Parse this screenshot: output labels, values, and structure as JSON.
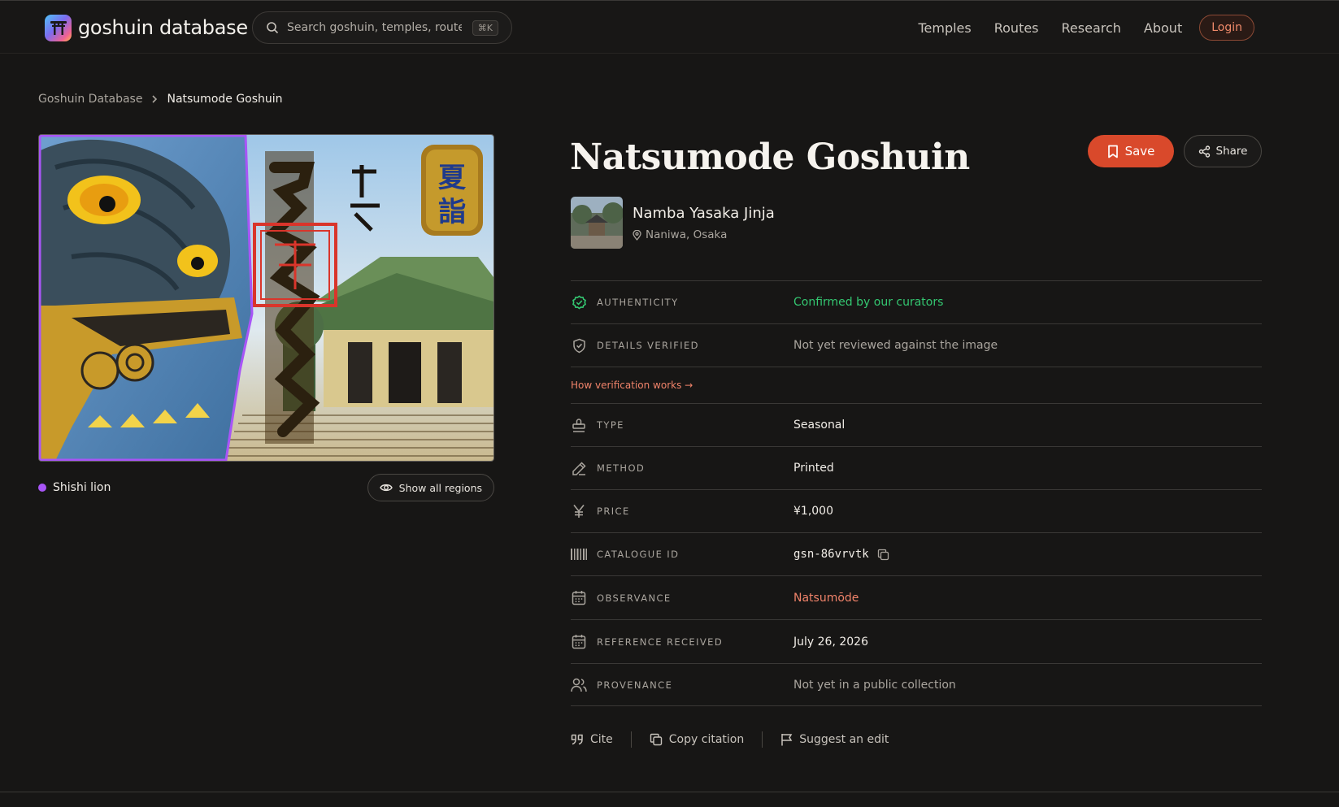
{
  "header": {
    "brand": "goshuin database",
    "search": {
      "placeholder": "Search goshuin, temples, routes",
      "shortcut": "⌘K"
    },
    "nav": [
      "Temples",
      "Routes",
      "Research",
      "About"
    ],
    "login": "Login"
  },
  "breadcrumb": {
    "parent": "Goshuin Database",
    "current": "Natsumode Goshuin"
  },
  "image": {
    "region_label": "Shishi lion",
    "region_color": "#a855f7",
    "show_regions_label": "Show all regions",
    "stamp_text": "夏詣"
  },
  "detail": {
    "title": "Natsumode Goshuin",
    "save_label": "Save",
    "share_label": "Share",
    "temple_name": "Namba Yasaka Jinja",
    "temple_location": "Naniwa, Osaka",
    "authenticity": {
      "key": "Authenticity",
      "value": "Confirmed by our curators"
    },
    "details_verified": {
      "key": "Details verified",
      "value": "Not yet reviewed against the image"
    },
    "verification_link": "How verification works →",
    "type": {
      "key": "Type",
      "value": "Seasonal"
    },
    "method": {
      "key": "Method",
      "value": "Printed"
    },
    "price": {
      "key": "Price",
      "value": "¥1,000"
    },
    "catalogue_id": {
      "key": "Catalogue ID",
      "value": "gsn-86vrvtk"
    },
    "observance": {
      "key": "Observance",
      "value": "Natsumōde"
    },
    "reference_received": {
      "key": "Reference received",
      "value": "July 26, 2026"
    },
    "provenance": {
      "key": "Provenance",
      "value": "Not yet in a public collection"
    }
  },
  "actions": {
    "cite": "Cite",
    "copy_citation": "Copy citation",
    "suggest_edit": "Suggest an edit"
  },
  "colors": {
    "accent": "#d9492b",
    "success": "#34c771",
    "link": "#f0836a",
    "background": "#171615"
  }
}
